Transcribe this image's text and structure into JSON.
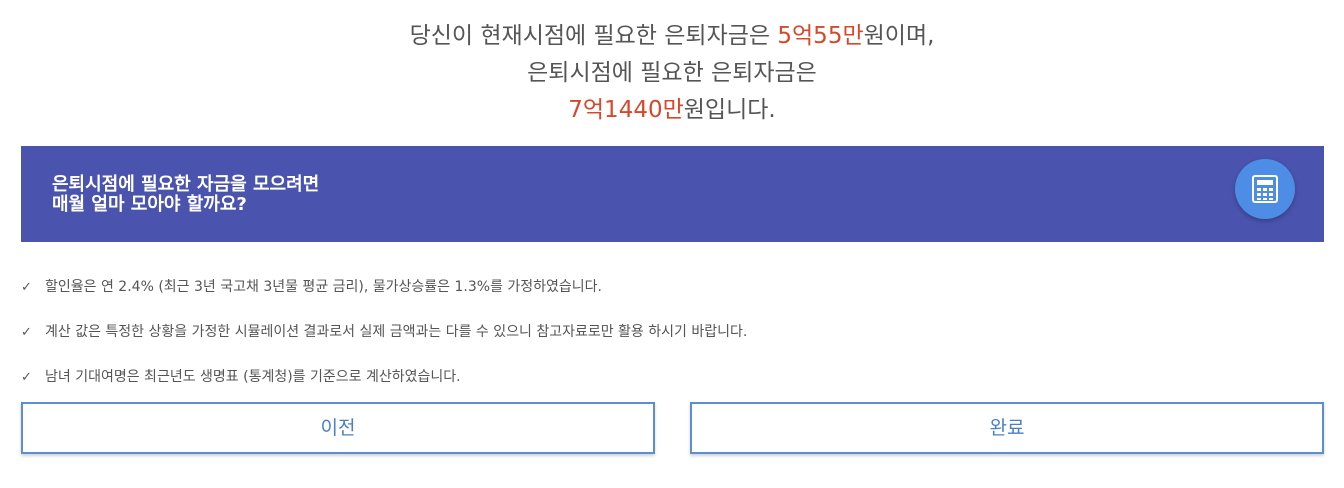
{
  "result": {
    "line1_before": "당신이 현재시점에 필요한 은퇴자금은 ",
    "line1_amount": "5억55만",
    "line1_after": "원이며,",
    "line2": "은퇴시점에 필요한 은퇴자금은",
    "line3_amount": "7억1440만",
    "line3_after": "원입니다."
  },
  "banner": {
    "line1": "은퇴시점에 필요한 자금을 모으려면",
    "line2": "매월 얼마 모아야 할까요?",
    "icon": "calculator-icon",
    "bg_color": "#4a53ae",
    "button_color": "#4e8de6"
  },
  "notes": [
    {
      "icon": "check-icon",
      "text": "할인율은 연 2.4% (최근 3년 국고채 3년물 평균 금리), 물가상승률은 1.3%를 가정하였습니다."
    },
    {
      "icon": "check-icon",
      "text": "계산 값은 특정한 상황을 가정한 시뮬레이션 결과로서 실제 금액과는 다를 수 있으니 참고자료로만 활용 하시기 바랍니다."
    },
    {
      "icon": "check-icon",
      "text": "남녀 기대여명은 최근년도 생명표 (통계청)를 기준으로 계산하였습니다."
    }
  ],
  "buttons": {
    "prev_label": "이전",
    "done_label": "완료",
    "border_color": "#5b8fd0"
  },
  "colors": {
    "highlight": "#d9472b"
  }
}
